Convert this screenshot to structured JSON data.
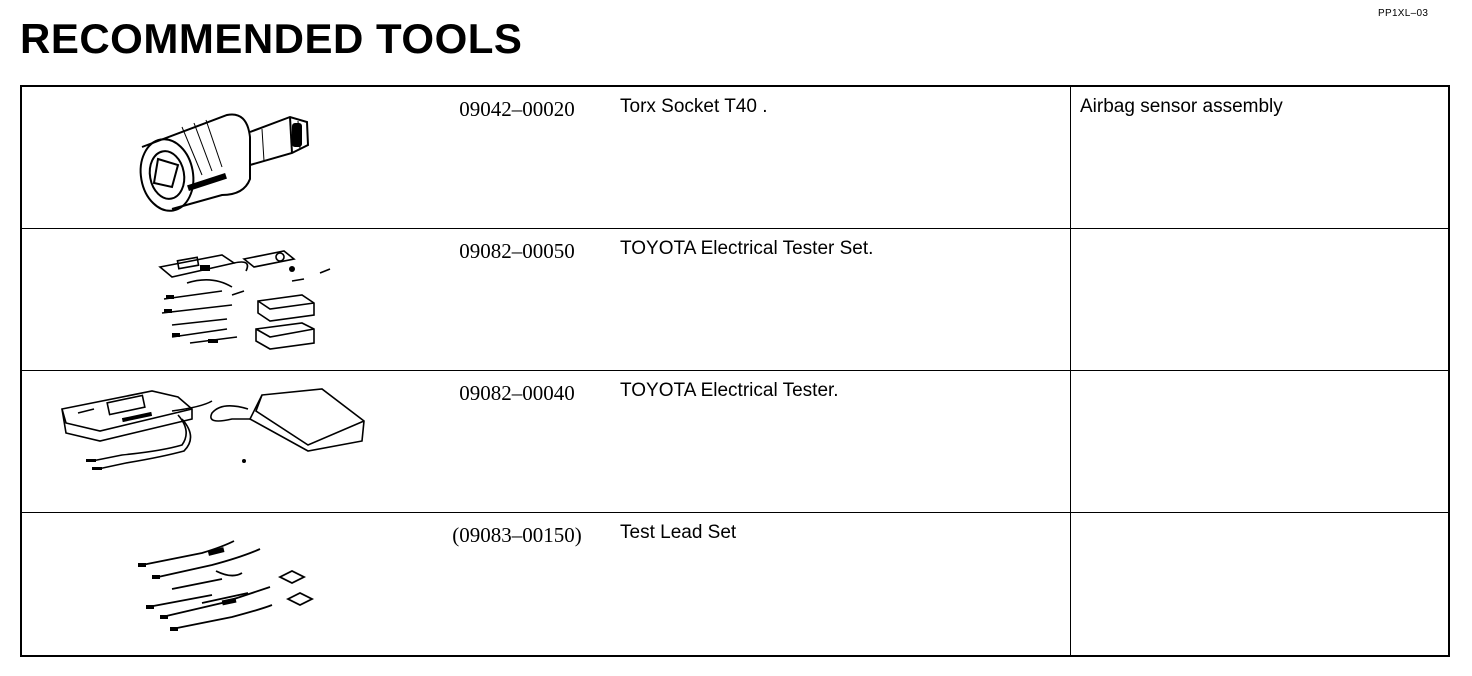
{
  "header": {
    "title": "RECOMMENDED TOOLS",
    "doc_code": "PP1XL–03"
  },
  "tools": [
    {
      "part_no": "09042–00020",
      "name": "Torx Socket T40 .",
      "application": "Airbag sensor assembly",
      "illustration": "torx-socket-illustration"
    },
    {
      "part_no": "09082–00050",
      "name": "TOYOTA Electrical Tester Set.",
      "application": "",
      "illustration": "tester-set-illustration"
    },
    {
      "part_no": "09082–00040",
      "name": "TOYOTA Electrical Tester.",
      "application": "",
      "illustration": "electrical-tester-illustration"
    },
    {
      "part_no": "(09083–00150)",
      "name": "Test Lead Set",
      "application": "",
      "illustration": "test-lead-set-illustration"
    }
  ]
}
